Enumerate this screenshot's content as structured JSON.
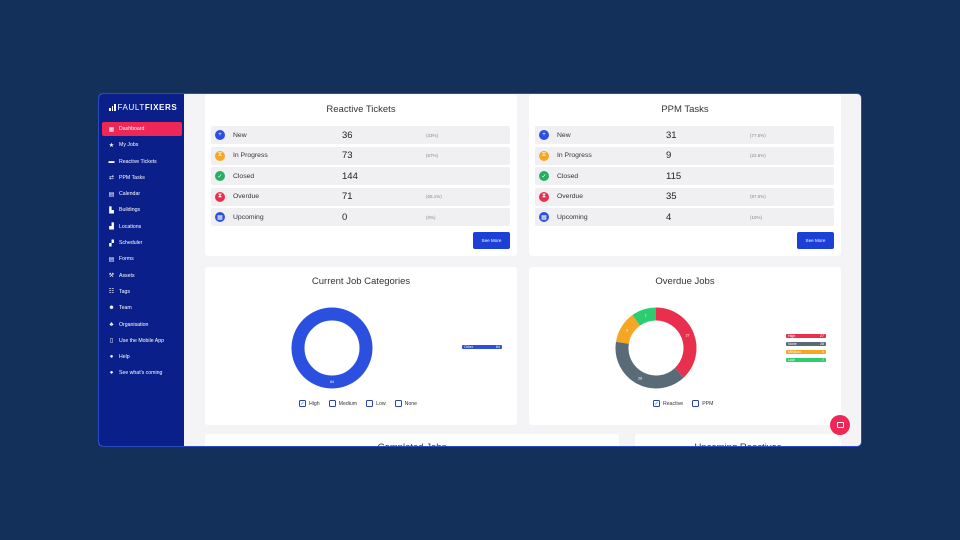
{
  "brand": {
    "light": "FAULT",
    "bold": "FIXERS"
  },
  "nav": [
    {
      "label": "Dashboard",
      "icon": "grid-icon",
      "glyph": "▦",
      "active": true
    },
    {
      "label": "My Jobs",
      "icon": "star-icon",
      "glyph": "★"
    },
    {
      "label": "Reactive Tickets",
      "icon": "ticket-icon",
      "glyph": "▬"
    },
    {
      "label": "PPM Tasks",
      "icon": "repeat-icon",
      "glyph": "⇄"
    },
    {
      "label": "Calendar",
      "icon": "calendar-icon",
      "glyph": "▤"
    },
    {
      "label": "Buildings",
      "icon": "building-icon",
      "glyph": "▙"
    },
    {
      "label": "Locations",
      "icon": "location-icon",
      "glyph": "▟"
    },
    {
      "label": "Scheduler",
      "icon": "scheduler-icon",
      "glyph": "▞"
    },
    {
      "label": "Forms",
      "icon": "form-icon",
      "glyph": "▤"
    },
    {
      "label": "Assets",
      "icon": "hammer-icon",
      "glyph": "⚒"
    },
    {
      "label": "Tags",
      "icon": "tag-icon",
      "glyph": "☷"
    },
    {
      "label": "Team",
      "icon": "team-icon",
      "glyph": "☻"
    },
    {
      "label": "Organisation",
      "icon": "org-icon",
      "glyph": "♣"
    },
    {
      "label": "Use the Mobile App",
      "icon": "mobile-icon",
      "glyph": "▯"
    },
    {
      "label": "Help",
      "icon": "help-icon",
      "glyph": "●"
    },
    {
      "label": "See what's coming",
      "icon": "chat-icon",
      "glyph": "●"
    }
  ],
  "reactive": {
    "title": "Reactive Tickets",
    "see_more": "See More",
    "rows": [
      {
        "label": "New",
        "count": "36",
        "pct": "(33%)",
        "color": "#2b50e0",
        "glyph": "+"
      },
      {
        "label": "In Progress",
        "count": "73",
        "pct": "(67%)",
        "color": "#f5a623",
        "glyph": "⧖"
      },
      {
        "label": "Closed",
        "count": "144",
        "pct": "",
        "color": "#27ae60",
        "glyph": "✓"
      },
      {
        "label": "Overdue",
        "count": "71",
        "pct": "(65.1%)",
        "color": "#e8304e",
        "glyph": "⧗"
      },
      {
        "label": "Upcoming",
        "count": "0",
        "pct": "(0%)",
        "color": "#2b50e0",
        "glyph": "▦"
      }
    ]
  },
  "ppm": {
    "title": "PPM Tasks",
    "see_more": "See More",
    "rows": [
      {
        "label": "New",
        "count": "31",
        "pct": "(77.5%)",
        "color": "#2b50e0",
        "glyph": "+"
      },
      {
        "label": "In Progress",
        "count": "9",
        "pct": "(22.5%)",
        "color": "#f5a623",
        "glyph": "⧖"
      },
      {
        "label": "Closed",
        "count": "115",
        "pct": "",
        "color": "#27ae60",
        "glyph": "✓"
      },
      {
        "label": "Overdue",
        "count": "35",
        "pct": "(87.5%)",
        "color": "#e8304e",
        "glyph": "⧗"
      },
      {
        "label": "Upcoming",
        "count": "4",
        "pct": "(10%)",
        "color": "#2b50e0",
        "glyph": "▦"
      }
    ]
  },
  "categories": {
    "title": "Current Job Categories",
    "legend": [
      {
        "label": "High",
        "checked": true
      },
      {
        "label": "Medium",
        "checked": false
      },
      {
        "label": "Low",
        "checked": false
      },
      {
        "label": "None",
        "checked": false
      }
    ],
    "pill": {
      "label": "Other",
      "value": "84",
      "color": "#2b50e0"
    },
    "slice_label": "84"
  },
  "overdue": {
    "title": "Overdue Jobs",
    "legend": [
      {
        "label": "Reactive",
        "checked": true
      },
      {
        "label": "PPM",
        "checked": false
      }
    ],
    "pills": [
      {
        "label": "High",
        "value": "27",
        "color": "#e8304e"
      },
      {
        "label": "None",
        "value": "28",
        "color": "#5a6b78"
      },
      {
        "label": "Medium",
        "value": "9",
        "color": "#f5a623"
      },
      {
        "label": "Low",
        "value": "7",
        "color": "#2ecc71"
      }
    ]
  },
  "chart_data": [
    {
      "type": "pie",
      "title": "Current Job Categories",
      "categories": [
        "Other"
      ],
      "values": [
        84
      ],
      "colors": [
        "#2b50e0"
      ]
    },
    {
      "type": "pie",
      "title": "Overdue Jobs",
      "categories": [
        "High",
        "None",
        "Medium",
        "Low"
      ],
      "values": [
        27,
        28,
        9,
        7
      ],
      "colors": [
        "#e8304e",
        "#5a6b78",
        "#f5a623",
        "#2ecc71"
      ]
    }
  ],
  "bottom": {
    "left_title": "Completed Jobs",
    "right_title": "Upcoming Reactives"
  }
}
